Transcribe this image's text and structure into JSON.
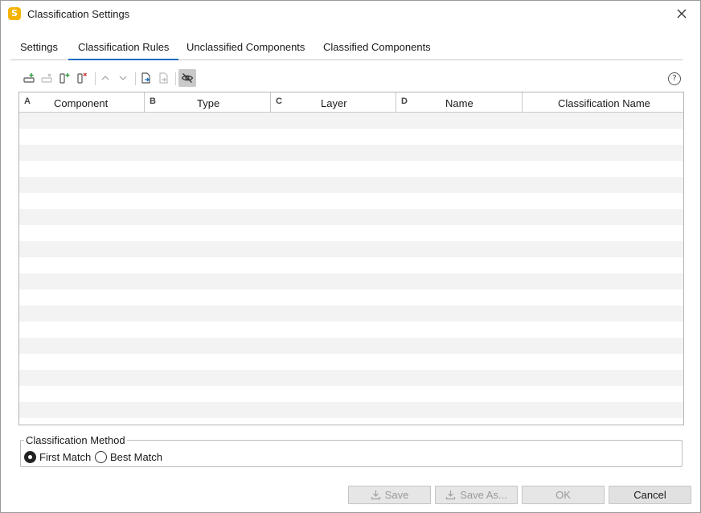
{
  "window": {
    "title": "Classification Settings",
    "app_icon_letter": "S",
    "accent_color": "#1b6ec2",
    "app_icon_color": "#f5b400"
  },
  "tabs": [
    {
      "label": "Settings",
      "active": false
    },
    {
      "label": "Classification Rules",
      "active": true
    },
    {
      "label": "Unclassified Components",
      "active": false
    },
    {
      "label": "Classified Components",
      "active": false
    }
  ],
  "toolbar": {
    "buttons": [
      {
        "icon": "add-row-icon",
        "enabled": true
      },
      {
        "icon": "delete-row-icon",
        "enabled": false
      },
      {
        "icon": "add-column-icon",
        "enabled": true
      },
      {
        "icon": "delete-column-icon",
        "enabled": true
      },
      {
        "icon": "move-up-icon",
        "enabled": false
      },
      {
        "icon": "move-down-icon",
        "enabled": false
      },
      {
        "icon": "import-icon",
        "enabled": true
      },
      {
        "icon": "export-icon",
        "enabled": false
      },
      {
        "icon": "hide-icon",
        "enabled": true,
        "pressed": true
      }
    ],
    "help_label": "?"
  },
  "grid": {
    "columns": [
      {
        "letter": "A",
        "label": "Component"
      },
      {
        "letter": "B",
        "label": "Type"
      },
      {
        "letter": "C",
        "label": "Layer"
      },
      {
        "letter": "D",
        "label": "Name"
      },
      {
        "letter": "",
        "label": "Classification Name"
      }
    ],
    "rows": []
  },
  "classification_method": {
    "legend": "Classification Method",
    "options": [
      {
        "label": "First Match",
        "checked": true
      },
      {
        "label": "Best Match",
        "checked": false
      }
    ]
  },
  "buttons": {
    "save": "Save",
    "save_as": "Save As...",
    "ok": "OK",
    "cancel": "Cancel"
  }
}
